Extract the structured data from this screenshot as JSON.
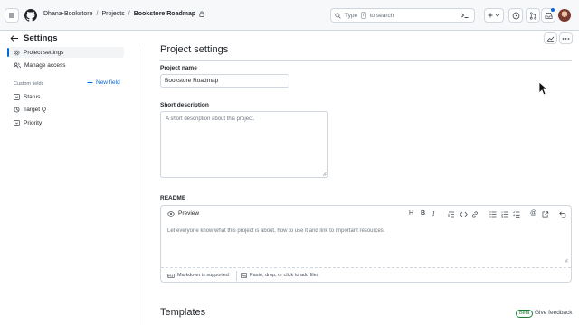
{
  "breadcrumb": {
    "owner": "Dhana-Bookstore",
    "section": "Projects",
    "project": "Bookstore Roadmap",
    "separator": "/"
  },
  "search": {
    "prefix": "Type",
    "shortcut": "/",
    "suffix": "to search"
  },
  "settings_header": {
    "title": "Settings"
  },
  "sidebar": {
    "items": [
      {
        "label": "Project settings",
        "icon": "gear-icon",
        "active": true
      },
      {
        "label": "Manage access",
        "icon": "people-icon",
        "active": false
      }
    ],
    "custom_fields_heading": "Custom fields",
    "new_field_label": "New field",
    "fields": [
      {
        "label": "Status",
        "icon": "single-select-icon"
      },
      {
        "label": "Target Q",
        "icon": "iteration-icon"
      },
      {
        "label": "Priority",
        "icon": "single-select-icon"
      }
    ]
  },
  "main": {
    "section_title": "Project settings",
    "project_name_label": "Project name",
    "project_name_value": "Bookstore Roadmap",
    "short_description_label": "Short description",
    "short_description_placeholder": "A short description about this project.",
    "readme_label": "README",
    "readme_tab": "Preview",
    "readme_placeholder": "Let everyone know what this project is about, how to use it and link to important resources.",
    "markdown_note": "Markdown is supported",
    "attach_note": "Paste, drop, or click to add files",
    "toolbar": [
      "H",
      "B",
      "I",
      "quote",
      "code",
      "link",
      "ul",
      "ol",
      "tasks",
      "@",
      "ref",
      "undo"
    ],
    "templates_title": "Templates",
    "beta_badge": "Beta",
    "feedback_link": "Give feedback"
  },
  "colors": {
    "accent": "#0969da",
    "border": "#d0d7de",
    "header_bg": "#f6f8fa",
    "beta": "#1a7f37"
  }
}
